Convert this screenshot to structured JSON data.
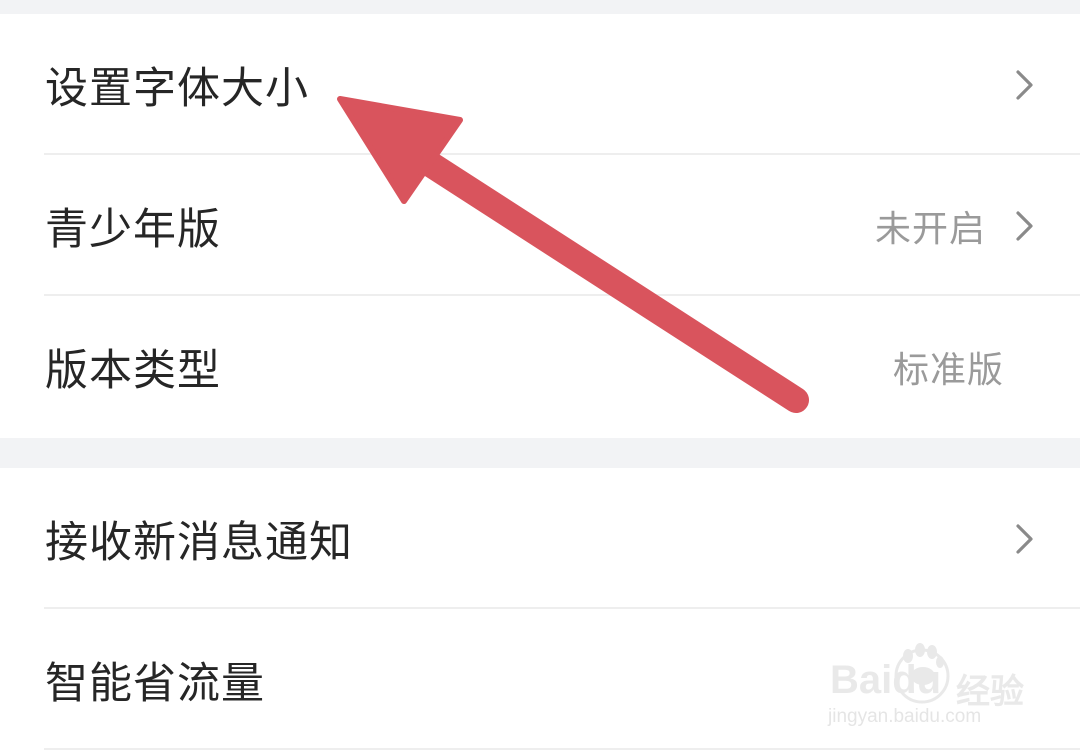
{
  "settings": {
    "group1": [
      {
        "label": "设置字体大小",
        "value": "",
        "chevron": true
      },
      {
        "label": "青少年版",
        "value": "未开启",
        "chevron": true
      },
      {
        "label": "版本类型",
        "value": "标准版",
        "chevron": false
      }
    ],
    "group2": [
      {
        "label": "接收新消息通知",
        "value": "",
        "chevron": true
      },
      {
        "label": "智能省流量",
        "value": "",
        "chevron": false
      }
    ]
  },
  "annotation": {
    "arrow_color": "#d9545d",
    "points_to": "设置字体大小"
  },
  "watermark": {
    "brand": "Baidu",
    "cn": "经验",
    "url": "jingyan.baidu.com"
  },
  "icons": {
    "chevron": "chevron-right-icon",
    "paw": "baidu-paw-icon"
  }
}
